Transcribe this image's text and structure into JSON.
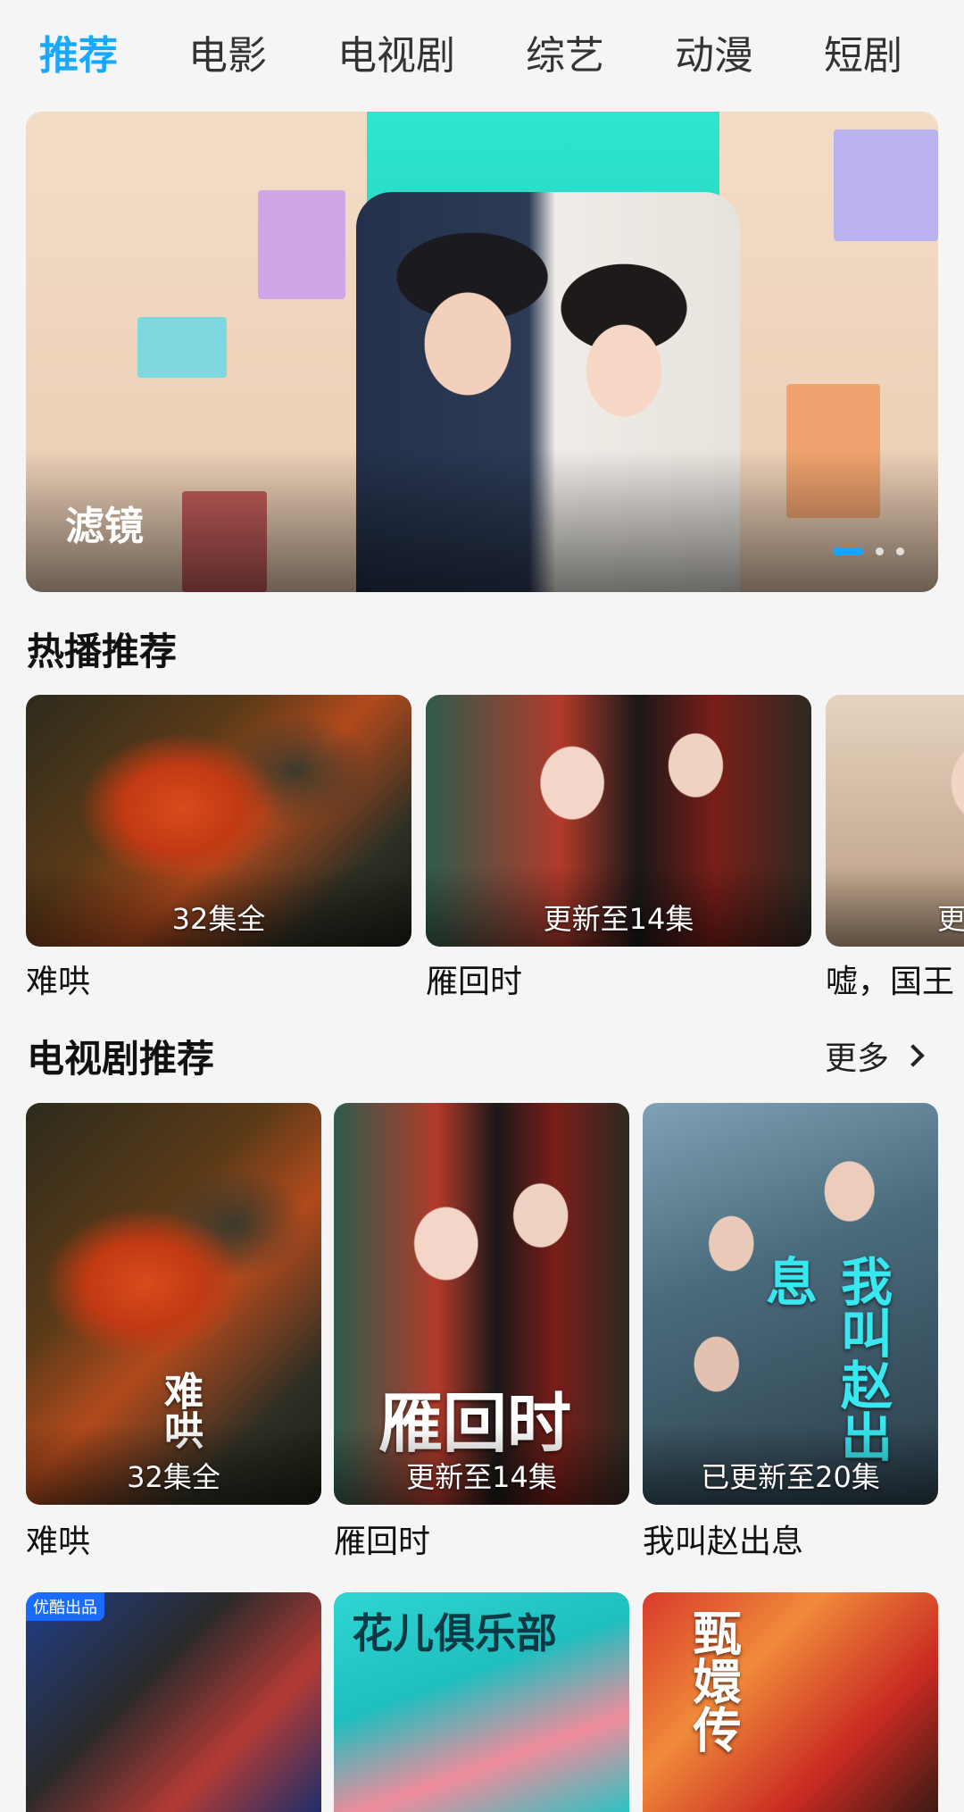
{
  "tabs": [
    "推荐",
    "电影",
    "电视剧",
    "综艺",
    "动漫",
    "短剧"
  ],
  "banner": {
    "title": "滤镜",
    "page_count": 3,
    "active_page": 1
  },
  "hot": {
    "title": "热播推荐",
    "items": [
      {
        "name": "难哄",
        "tag": "32集全"
      },
      {
        "name": "雁回时",
        "tag": "更新至14集"
      },
      {
        "name": "嘘，国王",
        "tag": "更"
      }
    ]
  },
  "tv": {
    "title": "电视剧推荐",
    "more": "更多",
    "items": [
      {
        "name": "难哄",
        "tag": "32集全",
        "poster_text": "难哄"
      },
      {
        "name": "雁回时",
        "tag": "更新至14集",
        "poster_text": "雁回时"
      },
      {
        "name": "我叫赵出息",
        "tag": "已更新至20集",
        "poster_text": "我叫赵出息"
      }
    ],
    "row2": [
      {
        "badge": "优酷出品"
      },
      {
        "poster_text": "花儿俱乐部"
      },
      {
        "poster_text": "甄嬛传"
      }
    ]
  }
}
